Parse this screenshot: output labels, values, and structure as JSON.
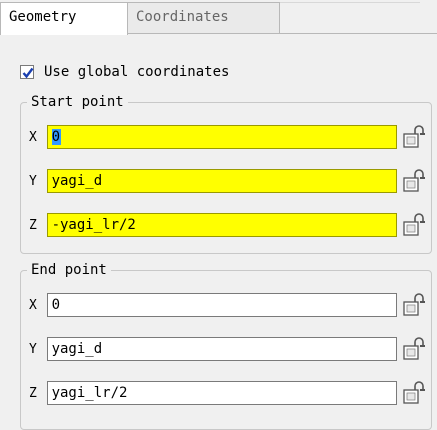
{
  "tabs": [
    {
      "label": "Geometry",
      "active": true
    },
    {
      "label": "Coordinates",
      "active": false
    }
  ],
  "options": {
    "use_global_label": "Use global coordinates",
    "use_global_checked": true
  },
  "start_point": {
    "title": "Start point",
    "fields": [
      {
        "axis": "X",
        "value": "0",
        "highlighted": true,
        "selected": true
      },
      {
        "axis": "Y",
        "value": "yagi_d",
        "highlighted": true
      },
      {
        "axis": "Z",
        "value": "-yagi_lr/2",
        "highlighted": true
      }
    ]
  },
  "end_point": {
    "title": "End point",
    "fields": [
      {
        "axis": "X",
        "value": "0",
        "highlighted": false
      },
      {
        "axis": "Y",
        "value": "yagi_d",
        "highlighted": false
      },
      {
        "axis": "Z",
        "value": "yagi_lr/2",
        "highlighted": false
      }
    ]
  },
  "colors": {
    "highlight": "#ffff00",
    "selection": "#3399ff"
  },
  "icons": {
    "lock": "lock-icon"
  }
}
